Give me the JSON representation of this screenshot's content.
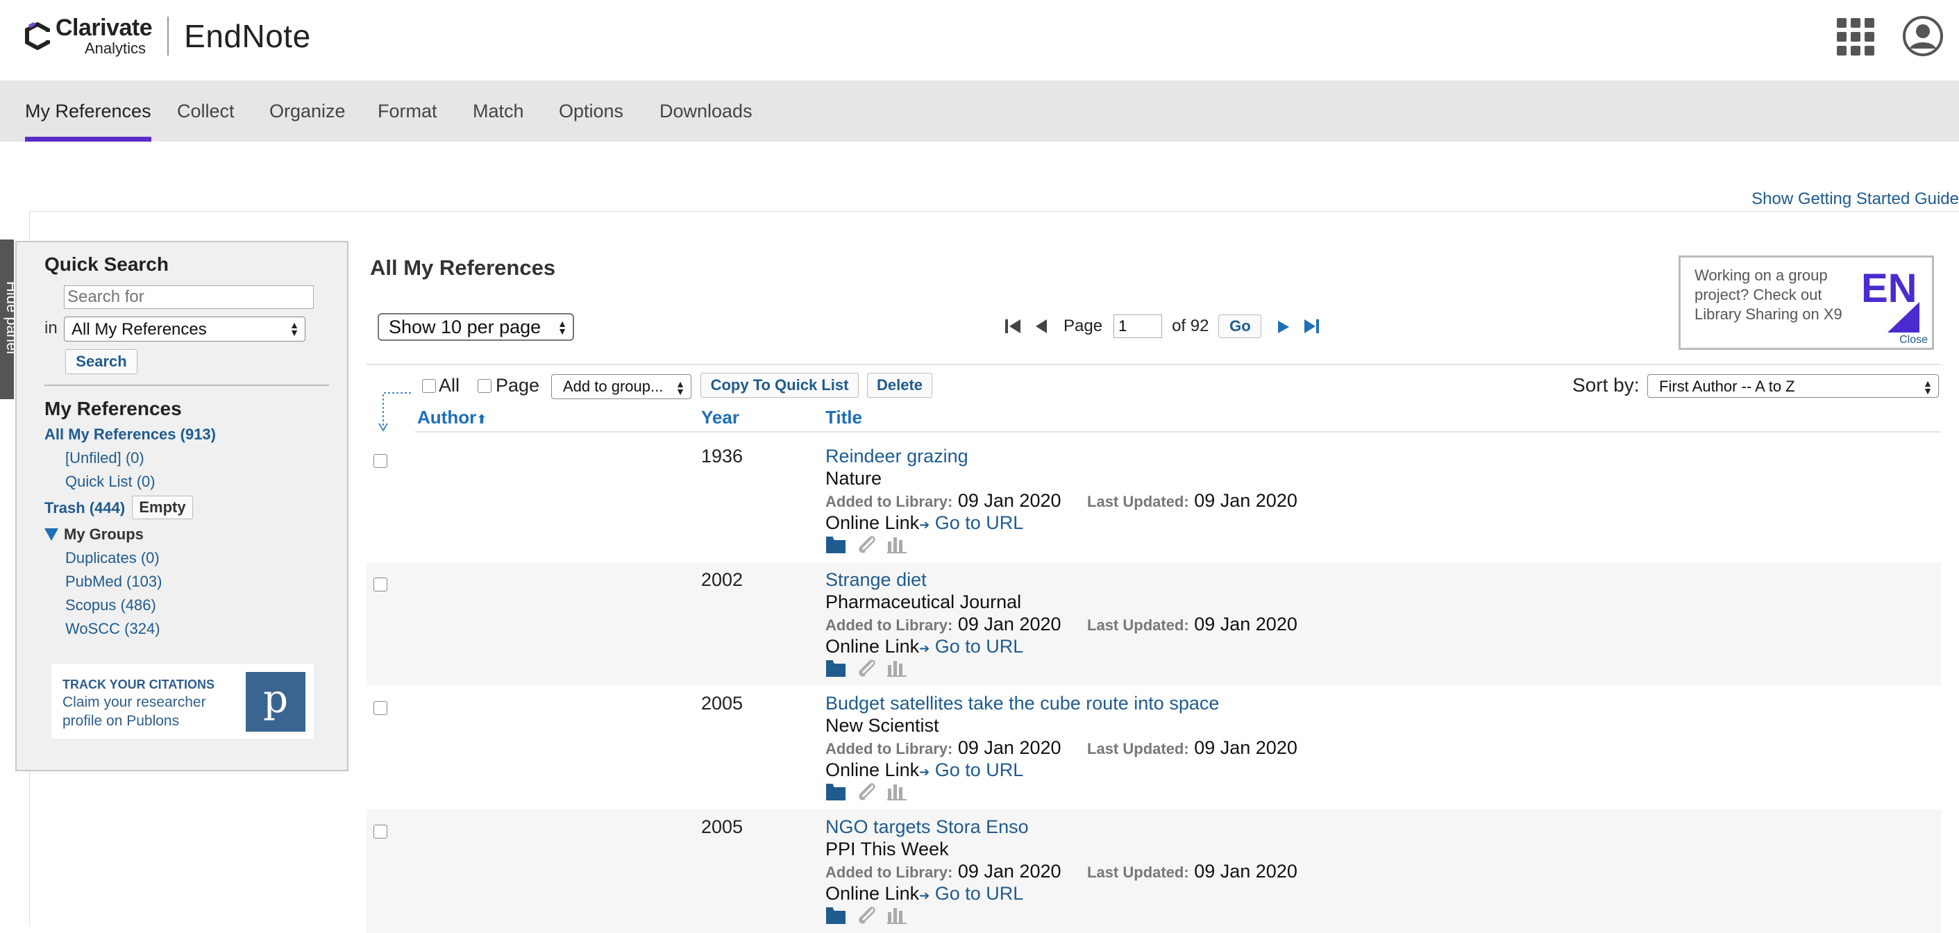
{
  "header": {
    "brand_name": "Clarivate",
    "brand_sub": "Analytics",
    "product": "EndNote"
  },
  "nav": {
    "tabs": [
      {
        "label": "My References",
        "active": true
      },
      {
        "label": "Collect",
        "active": false
      },
      {
        "label": "Organize",
        "active": false
      },
      {
        "label": "Format",
        "active": false
      },
      {
        "label": "Match",
        "active": false
      },
      {
        "label": "Options",
        "active": false
      },
      {
        "label": "Downloads",
        "active": false
      }
    ]
  },
  "getting_started": "Show Getting Started Guide",
  "hide_panel": "Hide panel",
  "quick_search": {
    "heading": "Quick Search",
    "placeholder": "Search for",
    "in_label": "in",
    "scope": "All My References",
    "button": "Search"
  },
  "my_references": {
    "heading": "My References",
    "all": "All My References (913)",
    "unfiled": "[Unfiled] (0)",
    "quick_list": "Quick List (0)",
    "trash": "Trash (444)",
    "empty_button": "Empty",
    "groups_label": "My Groups",
    "groups": [
      {
        "label": "Duplicates  (0)"
      },
      {
        "label": "PubMed  (103)"
      },
      {
        "label": "Scopus  (486)"
      },
      {
        "label": "WoSCC  (324)"
      }
    ]
  },
  "publons": {
    "title": "TRACK YOUR CITATIONS",
    "text": "Claim your researcher profile on Publons",
    "logo_letter": "p"
  },
  "main": {
    "title": "All My References",
    "per_page": "Show 10 per page",
    "pager": {
      "page_label": "Page",
      "page_value": "1",
      "of_label": "of 92",
      "go": "Go"
    },
    "ad": {
      "text": "Working on a group project? Check out Library Sharing on X9",
      "logo": "EN",
      "close": "Close"
    },
    "toolbar": {
      "all_label": "All",
      "page_label": "Page",
      "add_to_group": "Add to group...",
      "copy_quick_list": "Copy To Quick List",
      "delete": "Delete",
      "sort_by_label": "Sort by:",
      "sort_by_value": "First Author -- A to Z"
    },
    "columns": {
      "author": "Author",
      "year": "Year",
      "title": "Title"
    },
    "meta_labels": {
      "added": "Added to Library:",
      "updated": "Last Updated:",
      "online_link": "Online Link",
      "go_to_url": "Go to URL"
    },
    "references": [
      {
        "year": "1936",
        "title": "Reindeer grazing",
        "journal": "Nature",
        "added": "09 Jan 2020",
        "updated": "09 Jan 2020"
      },
      {
        "year": "2002",
        "title": "Strange diet",
        "journal": "Pharmaceutical Journal",
        "added": "09 Jan 2020",
        "updated": "09 Jan 2020"
      },
      {
        "year": "2005",
        "title": "Budget satellites take the cube route into space",
        "journal": "New Scientist",
        "added": "09 Jan 2020",
        "updated": "09 Jan 2020"
      },
      {
        "year": "2005",
        "title": "NGO targets Stora Enso",
        "journal": "PPI This Week",
        "added": "09 Jan 2020",
        "updated": "09 Jan 2020"
      }
    ]
  },
  "colors": {
    "accent": "#5b2bc8",
    "link": "#1f5b8e",
    "header_link": "#1f6fb5",
    "nav_bg": "#e6e6e6"
  }
}
